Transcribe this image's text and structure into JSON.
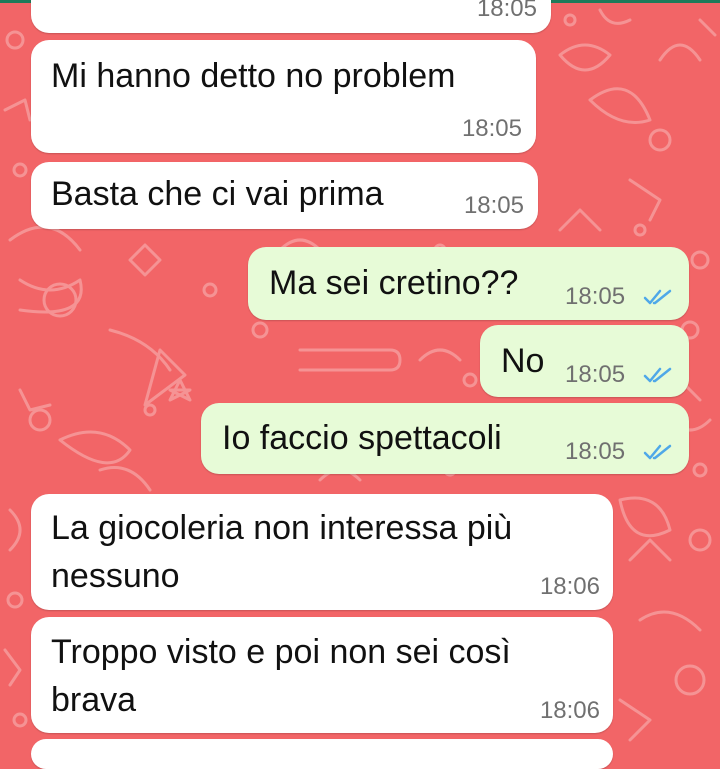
{
  "colors": {
    "wallpaper": "#f26567",
    "incoming_bubble": "#ffffff",
    "outgoing_bubble": "#e7fbd7",
    "read_ticks": "#4fa8e8",
    "timestamp": "#707070"
  },
  "chat": {
    "partial_top_time": "18:05",
    "messages": [
      {
        "direction": "incoming",
        "text": "Mi hanno detto no problem",
        "time": "18:05"
      },
      {
        "direction": "incoming",
        "text": "Basta che ci vai prima",
        "time": "18:05"
      },
      {
        "direction": "outgoing",
        "text": "Ma sei cretino??",
        "time": "18:05",
        "status_icon": "double-check-read-icon"
      },
      {
        "direction": "outgoing",
        "text": "No",
        "time": "18:05",
        "status_icon": "double-check-read-icon"
      },
      {
        "direction": "outgoing",
        "text": "Io faccio spettacoli",
        "time": "18:05",
        "status_icon": "double-check-read-icon"
      },
      {
        "direction": "incoming",
        "text": "La giocoleria non interessa più\nnessuno",
        "time": "18:06"
      },
      {
        "direction": "incoming",
        "text": "Troppo visto e poi non sei così\nbrava",
        "time": "18:06"
      }
    ]
  }
}
